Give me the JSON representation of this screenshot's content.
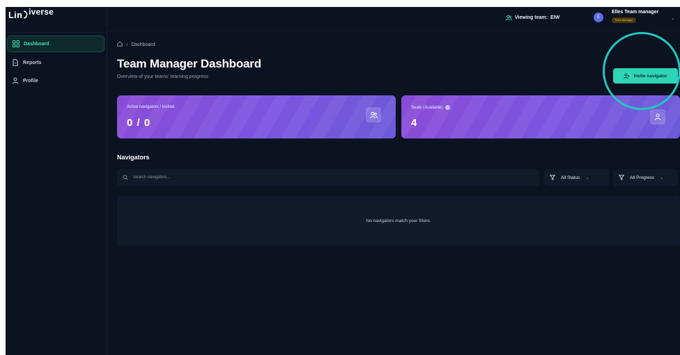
{
  "app": {
    "logo_prefix": "Lin",
    "logo_suffix": "iverse"
  },
  "sidebar": {
    "items": [
      {
        "label": "Dashboard",
        "icon": "grid-icon",
        "active": true
      },
      {
        "label": "Reports",
        "icon": "document-icon",
        "active": false
      },
      {
        "label": "Profile",
        "icon": "user-icon",
        "active": false
      }
    ]
  },
  "topbar": {
    "viewing_label": "Viewing team:",
    "team_code": "EIW",
    "avatar_initial": "E",
    "user_name": "Elles Team manager",
    "role_badge": "Team Manager"
  },
  "breadcrumb": {
    "home_icon": "home-icon",
    "current": "Dashboard"
  },
  "header": {
    "title": "Team Manager Dashboard",
    "subtitle": "Overview of your teams' learning progress",
    "invite_button": "Invite navigator"
  },
  "stats": [
    {
      "label": "Active navigators / Invited",
      "value": "0 / 0",
      "icon": "users-icon"
    },
    {
      "label": "Seats (Available)",
      "value": "4",
      "icon": "user-icon"
    }
  ],
  "navigators": {
    "section_title": "Navigators",
    "search_placeholder": "Search navigators...",
    "filter_status": "All Status",
    "filter_progress": "All Progress",
    "empty_message": "No navigators match your filters."
  },
  "colors": {
    "accent": "#2fd4b6",
    "card_gradient_start": "#8a4bd6",
    "card_gradient_end": "#6c5ad8",
    "highlight_ring": "#22c6c0"
  }
}
